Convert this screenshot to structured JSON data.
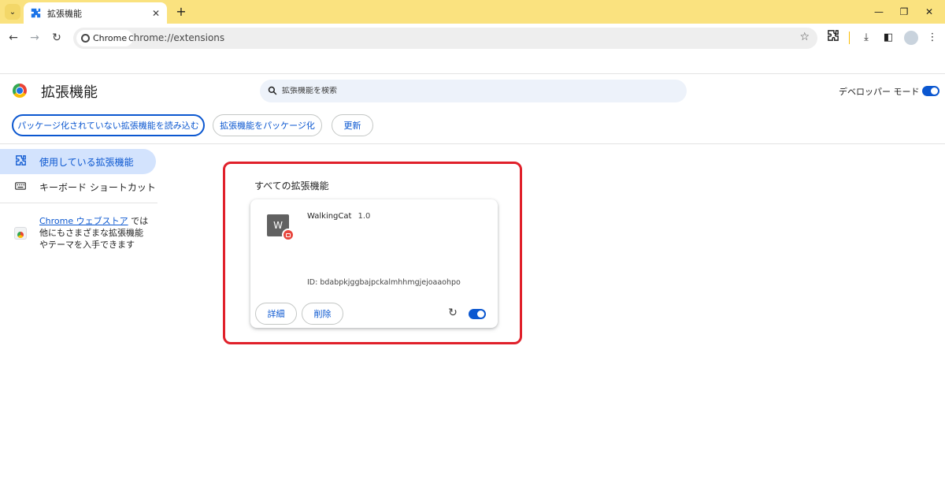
{
  "browser": {
    "tab_title": "拡張機能",
    "tab_favicon": "puzzle-icon",
    "chip_label": "Chrome",
    "url": "chrome://extensions"
  },
  "header": {
    "title": "拡張機能",
    "search_placeholder": "拡張機能を検索",
    "dev_mode_label": "デベロッパー モード",
    "dev_mode_on": true
  },
  "actions": {
    "load_unpacked": "パッケージ化されていない拡張機能を読み込む",
    "pack": "拡張機能をパッケージ化",
    "update": "更新"
  },
  "sidebar": {
    "items": [
      {
        "label": "使用している拡張機能",
        "icon": "puzzle-icon",
        "active": true
      },
      {
        "label": "キーボード ショートカット",
        "icon": "keyboard-icon",
        "active": false
      }
    ],
    "store_link": "Chrome ウェブストア",
    "store_text_1": "では",
    "store_text_2": "他にもさまざまな拡張機能",
    "store_text_3": "やテーマを入手できます"
  },
  "main": {
    "section_title": "すべての拡張機能",
    "extension": {
      "icon_letter": "W",
      "name": "WalkingCat",
      "version": "1.0",
      "id_text": "ID: bdabpkjggbajpckalmhhmgjejoaaohpo",
      "details_label": "詳細",
      "remove_label": "削除",
      "enabled": true
    }
  },
  "colors": {
    "accent": "#0b57d0",
    "tabstrip": "#fae27f",
    "highlight": "#e0202a"
  }
}
